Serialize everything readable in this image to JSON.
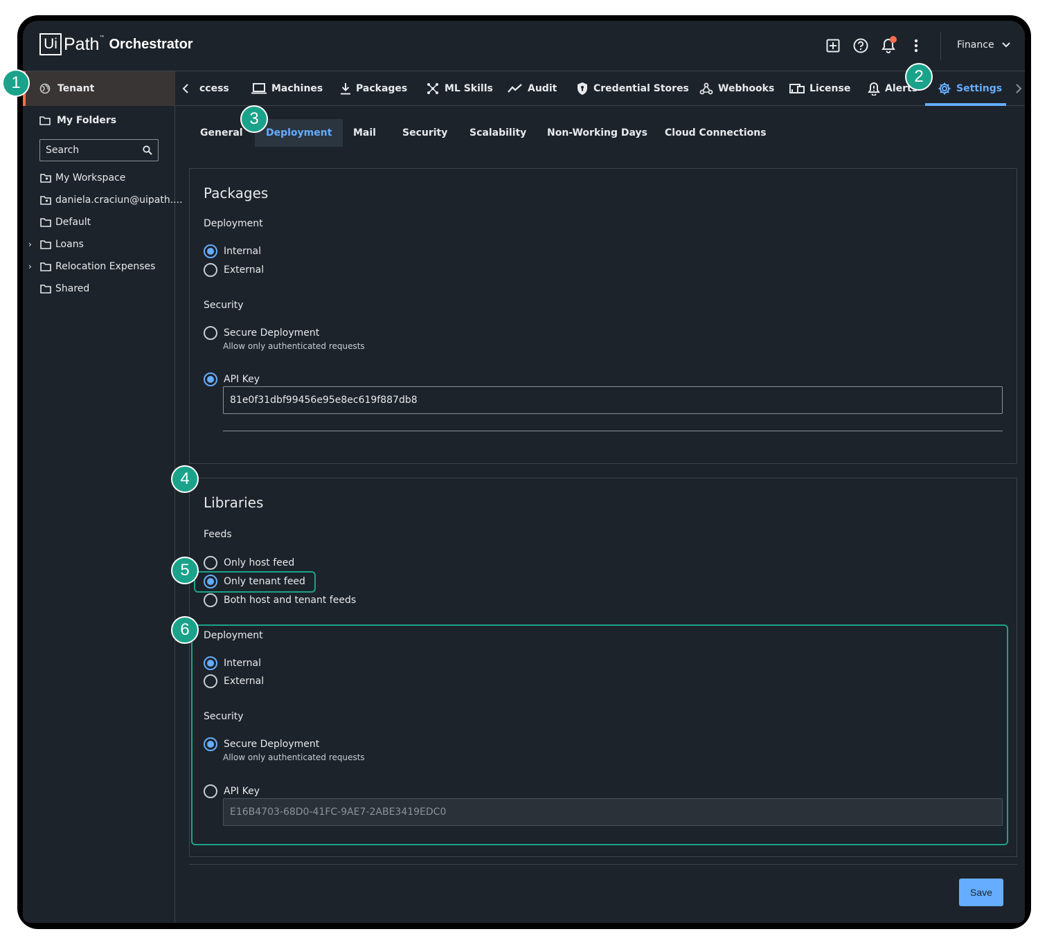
{
  "header": {
    "logo_ui": "Ui",
    "logo_path": "Path",
    "logo_tm": "™",
    "product": "Orchestrator",
    "tenant_selector": "Finance"
  },
  "sidebar": {
    "tenant_label": "Tenant",
    "my_folders": "My Folders",
    "search_placeholder": "Search",
    "items": [
      {
        "label": "My Workspace",
        "icon": "workspace-folder-icon"
      },
      {
        "label": "daniela.craciun@uipath....",
        "icon": "workspace-folder-icon"
      },
      {
        "label": "Default",
        "icon": "folder-icon"
      },
      {
        "label": "Loans",
        "icon": "folder-icon",
        "expandable": true
      },
      {
        "label": "Relocation Expenses",
        "icon": "folder-icon",
        "expandable": true
      },
      {
        "label": "Shared",
        "icon": "folder-icon"
      }
    ]
  },
  "topnav": {
    "items": [
      {
        "label": "ccess",
        "icon": ""
      },
      {
        "label": "Machines",
        "icon": "laptop-icon"
      },
      {
        "label": "Packages",
        "icon": "download-icon"
      },
      {
        "label": "ML Skills",
        "icon": "ml-skills-icon"
      },
      {
        "label": "Audit",
        "icon": "trend-icon"
      },
      {
        "label": "Credential Stores",
        "icon": "shield-icon"
      },
      {
        "label": "Webhooks",
        "icon": "webhook-icon"
      },
      {
        "label": "License",
        "icon": "license-icon"
      },
      {
        "label": "Alerts",
        "icon": "bell-icon"
      },
      {
        "label": "Settings",
        "icon": "gear-icon",
        "active": true
      }
    ]
  },
  "subtabs": [
    {
      "label": "General"
    },
    {
      "label": "Deployment",
      "active": true
    },
    {
      "label": "Mail"
    },
    {
      "label": "Security"
    },
    {
      "label": "Scalability"
    },
    {
      "label": "Non-Working Days"
    },
    {
      "label": "Cloud Connections"
    }
  ],
  "packages": {
    "title": "Packages",
    "deployment_label": "Deployment",
    "internal": "Internal",
    "external": "External",
    "deployment_selected": "Internal",
    "security_label": "Security",
    "secure_deployment": "Secure Deployment",
    "secure_hint": "Allow only authenticated requests",
    "api_key_label": "API Key",
    "security_selected": "API Key",
    "api_key_value": "81e0f31dbf99456e95e8ec619f887db8"
  },
  "libraries": {
    "title": "Libraries",
    "feeds_label": "Feeds",
    "only_host": "Only host feed",
    "only_tenant": "Only tenant feed",
    "both": "Both host and tenant feeds",
    "feeds_selected": "Only tenant feed",
    "deployment_label": "Deployment",
    "internal": "Internal",
    "external": "External",
    "deployment_selected": "Internal",
    "security_label": "Security",
    "secure_deployment": "Secure Deployment",
    "secure_hint": "Allow only authenticated requests",
    "api_key_label": "API Key",
    "security_selected": "Secure Deployment",
    "api_key_value": "E16B4703-68D0-41FC-9AE7-2ABE3419EDC0"
  },
  "save_label": "Save",
  "callouts": [
    "1",
    "2",
    "3",
    "4",
    "5",
    "6"
  ],
  "colors": {
    "accent": "#66adff",
    "callout": "#1aa38a",
    "background": "#1d232a",
    "tenant_accent": "#fa6c4b"
  }
}
